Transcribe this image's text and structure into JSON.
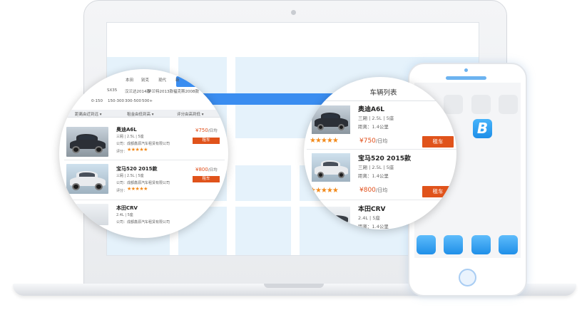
{
  "left_panel": {
    "filters_row1": [
      "本田",
      "别克",
      "现代",
      "新"
    ],
    "filters_row2": [
      "SX35",
      "汉兰达2014款",
      "伊兰特2013款",
      "福克斯2008款"
    ],
    "filters_row3": [
      "0-150",
      "150-300",
      "300-500",
      "500+"
    ],
    "sort": [
      "距离由近到远 ▾",
      "租金由低到高 ▾",
      "评分由高到低 ▾"
    ],
    "cars": [
      {
        "name": "奥迪A6L",
        "spec": "三厢 | 2.5L | 5座",
        "company": "公司：成都鑫源汽车租赁有限公司",
        "rating_label": "评分：",
        "stars": "★★★★★",
        "price": "¥750",
        "price_unit": "/日均",
        "button": "租车",
        "car_color": "#2b2f36"
      },
      {
        "name": "宝马520 2015款",
        "spec": "三厢 | 2.5L | 5座",
        "company": "公司：成都鑫源汽车租赁有限公司",
        "rating_label": "评分：",
        "stars": "★★★★★",
        "price": "¥800",
        "price_unit": "/日均",
        "button": "租车",
        "car_color": "#e9ebee"
      },
      {
        "name": "本田CRV",
        "spec": "2.4L | 5座",
        "company": "公司：成都鑫源汽车租赁有限公司"
      }
    ]
  },
  "right_panel": {
    "title": "车辆列表",
    "cars": [
      {
        "name": "奥迪A6L",
        "spec": "三厢 | 2.5L | 5座",
        "distance": "距离：1.4公里",
        "stars": "★★★★★",
        "price": "¥750",
        "price_unit": "/日均",
        "button": "租车",
        "car_color": "#2b2f36"
      },
      {
        "name": "宝马520 2015款",
        "spec": "三厢 | 2.5L | 5座",
        "distance": "距离：1.4公里",
        "stars": "★★★★★",
        "price": "¥800",
        "price_unit": "/日均",
        "button": "租车",
        "car_color": "#e9ebee"
      },
      {
        "name": "本田CRV",
        "spec": "2.4L | 5座",
        "distance": "距离：1.4公里"
      }
    ]
  },
  "phone": {
    "app_letter": "B"
  },
  "colors": {
    "accent_blue": "#3a8df0",
    "rent_orange": "#e0531b",
    "star_orange": "#f28a1c",
    "price_red": "#e04e1a"
  }
}
